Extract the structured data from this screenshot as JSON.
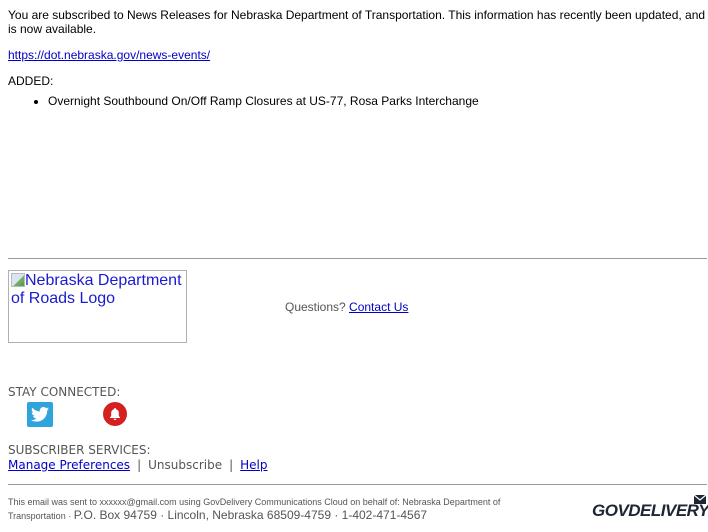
{
  "intro": "You are subscribed to News Releases for Nebraska Department of Transportation. This information has recently been updated, and is now available.",
  "link": "https://dot.nebraska.gov/news-events/",
  "added_label": "ADDED:",
  "items": [
    "Overnight Southbound On/Off Ramp Closures at US-77, Rosa Parks Interchange"
  ],
  "logo_alt": "Nebraska Department of Roads Logo",
  "questions_label": "Questions?",
  "contact_link": "Contact Us",
  "stay_connected": "STAY CONNECTED:",
  "social": [
    {
      "name": "twitter-icon",
      "color": "#2fa3dc"
    },
    {
      "name": "bell-icon",
      "color": "#d42020"
    }
  ],
  "subscriber_services": "SUBSCRIBER SERVICES:",
  "services": {
    "manage": "Manage Preferences",
    "separator": "|",
    "unsubscribe": "Unsubscribe",
    "help": "Help"
  },
  "footer": {
    "line1": "This email was sent to xxxxxx@gmail.com using GovDelivery Communications Cloud on behalf of: Nebraska Department of",
    "line2_small": "Transportation · ",
    "line2_big": "P.O. Box 94759 · Lincoln, Nebraska 68509-4759 · 1-402-471-4567",
    "brand": "GOVDELIVERY"
  }
}
